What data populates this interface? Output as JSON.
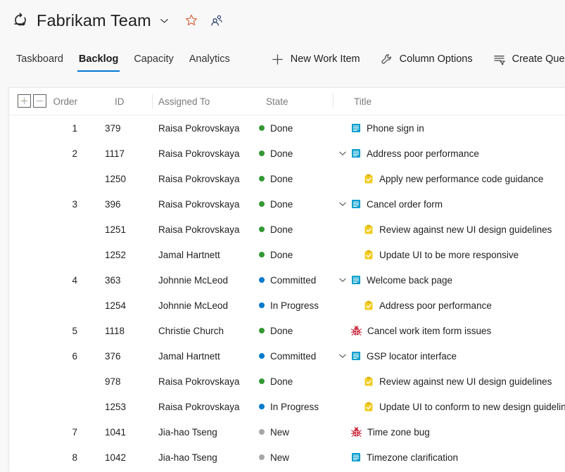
{
  "header": {
    "sprint_icon": "sprint-icon",
    "team_name": "Fabrikam Team",
    "chevron_icon": "chevron-down-icon",
    "favorite_icon": "star-icon",
    "team_members_icon": "people-icon"
  },
  "tabs": [
    {
      "label": "Taskboard",
      "active": false
    },
    {
      "label": "Backlog",
      "active": true
    },
    {
      "label": "Capacity",
      "active": false
    },
    {
      "label": "Analytics",
      "active": false
    }
  ],
  "toolbar": [
    {
      "label": "New Work Item",
      "icon": "plus-icon"
    },
    {
      "label": "Column Options",
      "icon": "wrench-icon"
    },
    {
      "label": "Create Query",
      "icon": "create-query-icon"
    }
  ],
  "grid": {
    "expand_all_label": "+",
    "collapse_all_label": "−",
    "columns": [
      {
        "key": "order",
        "label": "Order"
      },
      {
        "key": "id",
        "label": "ID"
      },
      {
        "key": "assigned",
        "label": "Assigned To"
      },
      {
        "key": "state",
        "label": "State"
      },
      {
        "key": "title",
        "label": "Title"
      }
    ],
    "state_colors": {
      "Done": "#339933",
      "Committed": "#007acc",
      "In Progress": "#007acc",
      "New": "#a6a6a6"
    },
    "type_colors": {
      "backlog_item": "#009ccc",
      "task": "#f2cb1d",
      "bug": "#cc293d"
    },
    "rows": [
      {
        "order": "1",
        "id": "379",
        "assigned": "Raisa Pokrovskaya",
        "state": "Done",
        "title": "Phone sign in",
        "type": "backlog_item",
        "child": false,
        "expandable": false
      },
      {
        "order": "2",
        "id": "1117",
        "assigned": "Raisa Pokrovskaya",
        "state": "Done",
        "title": "Address poor performance",
        "type": "backlog_item",
        "child": false,
        "expandable": true
      },
      {
        "order": "",
        "id": "1250",
        "assigned": "Raisa Pokrovskaya",
        "state": "Done",
        "title": "Apply new performance code guidance",
        "type": "task",
        "child": true,
        "expandable": false
      },
      {
        "order": "3",
        "id": "396",
        "assigned": "Raisa Pokrovskaya",
        "state": "Done",
        "title": "Cancel order form",
        "type": "backlog_item",
        "child": false,
        "expandable": true
      },
      {
        "order": "",
        "id": "1251",
        "assigned": "Raisa Pokrovskaya",
        "state": "Done",
        "title": "Review against new UI design guidelines",
        "type": "task",
        "child": true,
        "expandable": false
      },
      {
        "order": "",
        "id": "1252",
        "assigned": "Jamal Hartnett",
        "state": "Done",
        "title": "Update UI to be more responsive",
        "type": "task",
        "child": true,
        "expandable": false
      },
      {
        "order": "4",
        "id": "363",
        "assigned": "Johnnie McLeod",
        "state": "Committed",
        "title": "Welcome back page",
        "type": "backlog_item",
        "child": false,
        "expandable": true
      },
      {
        "order": "",
        "id": "1254",
        "assigned": "Johnnie McLeod",
        "state": "In Progress",
        "title": "Address poor performance",
        "type": "task",
        "child": true,
        "expandable": false
      },
      {
        "order": "5",
        "id": "1118",
        "assigned": "Christie Church",
        "state": "Done",
        "title": "Cancel work item form issues",
        "type": "bug",
        "child": false,
        "expandable": false
      },
      {
        "order": "6",
        "id": "376",
        "assigned": "Jamal Hartnett",
        "state": "Committed",
        "title": "GSP locator interface",
        "type": "backlog_item",
        "child": false,
        "expandable": true
      },
      {
        "order": "",
        "id": "978",
        "assigned": "Raisa Pokrovskaya",
        "state": "Done",
        "title": "Review against new UI design guidelines",
        "type": "task",
        "child": true,
        "expandable": false
      },
      {
        "order": "",
        "id": "1253",
        "assigned": "Raisa Pokrovskaya",
        "state": "In Progress",
        "title": "Update UI to conform to new design guidelines",
        "type": "task",
        "child": true,
        "expandable": false
      },
      {
        "order": "7",
        "id": "1041",
        "assigned": "Jia-hao Tseng",
        "state": "New",
        "title": "Time zone bug",
        "type": "bug",
        "child": false,
        "expandable": false
      },
      {
        "order": "8",
        "id": "1042",
        "assigned": "Jia-hao Tseng",
        "state": "New",
        "title": "Timezone clarification",
        "type": "backlog_item",
        "child": false,
        "expandable": false
      }
    ]
  }
}
